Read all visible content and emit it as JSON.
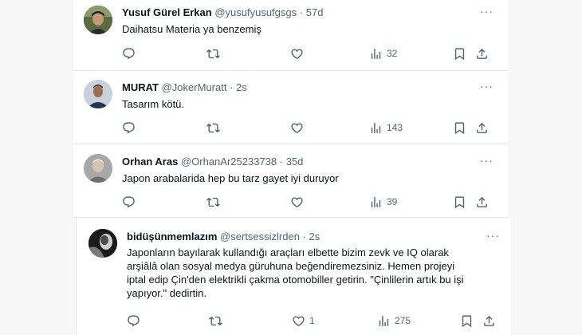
{
  "tweets": [
    {
      "name": "Yusuf Gürel Erkan",
      "handle": "@yusufyusufgsgs",
      "sep": "·",
      "time": "57d",
      "text": "Daihatsu Materia ya benzemiş",
      "stats": {
        "replies": "",
        "retweets": "",
        "likes": "",
        "views": "32"
      }
    },
    {
      "name": "MURAT",
      "handle": "@JokerMuratt",
      "sep": "·",
      "time": "2s",
      "text": "Tasarım kötü.",
      "stats": {
        "replies": "",
        "retweets": "",
        "likes": "",
        "views": "143"
      }
    },
    {
      "name": "Orhan Aras",
      "handle": "@OrhanAr25233738",
      "sep": "·",
      "time": "35d",
      "text": "Japon arabalarida hep bu tarz gayet iyi duruyor",
      "stats": {
        "replies": "",
        "retweets": "",
        "likes": "",
        "views": "39"
      }
    },
    {
      "name": "bidüşünmemlazım",
      "handle": "@sertsessizlrden",
      "sep": "·",
      "time": "2s",
      "lines": [
        "Japonların bayılarak kullandığı araçları elbette bizim zevk ve IQ olarak",
        "arşiâlâ olan sosyal medya güruhuna beğendiremezsiniz. Hemen projeyi",
        "iptal edip Çin'den elektrikli çakma otomobiller getirin. \"Çinlilerin artık bu işi",
        "yapıyor.\" dedirtin."
      ],
      "stats": {
        "replies": "",
        "retweets": "",
        "likes": "1",
        "views": "275"
      }
    }
  ],
  "more_label": "···",
  "icons": [
    "reply-icon",
    "retweet-icon",
    "like-icon",
    "views-icon",
    "bookmark-icon",
    "share-icon"
  ],
  "colors": {
    "text": "#0f1419",
    "secondary": "#536471",
    "border": "#e6e6e6"
  }
}
